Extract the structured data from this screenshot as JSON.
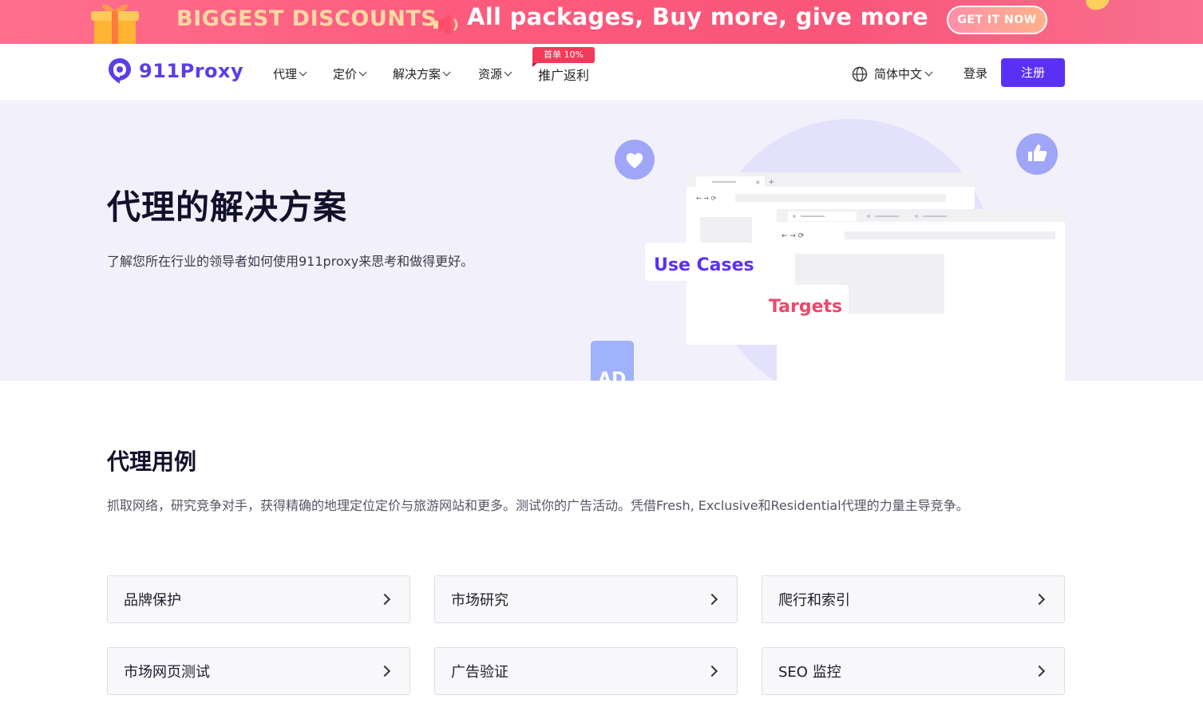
{
  "promo": {
    "headline": "BIGGEST DISCOUNTS",
    "slogan": "All packages, Buy more, give more",
    "cta": "GET IT NOW",
    "colors": {
      "background": "#fd5a7c",
      "headline": "#ffd9a3"
    }
  },
  "nav": {
    "logo_text": "911Proxy",
    "items": [
      {
        "label": "代理",
        "dropdown": true
      },
      {
        "label": "定价",
        "dropdown": true
      },
      {
        "label": "解决方案",
        "dropdown": true
      },
      {
        "label": "资源",
        "dropdown": true
      },
      {
        "label": "推广返利",
        "dropdown": false
      }
    ],
    "affiliate_badge": "首单 10%",
    "language": "简体中文",
    "login": "登录",
    "signup": "注册",
    "accent_color": "#5b30f6"
  },
  "hero": {
    "title": "代理的解决方案",
    "subtitle": "了解您所在行业的领导者如何使用911proxy来思考和做得更好。",
    "illustration": {
      "label_use_cases": "Use Cases",
      "label_targets": "Targets",
      "label_ad": "AD",
      "icons": [
        "heart-icon",
        "thumbs-up-icon"
      ]
    }
  },
  "use_cases": {
    "title": "代理用例",
    "description": "抓取网络，研究竞争对手，获得精确的地理定位定价与旅游网站和更多。测试你的广告活动。凭借Fresh, Exclusive和Residential代理的力量主导竞争。",
    "cards": [
      {
        "label": "品牌保护"
      },
      {
        "label": "市场研究"
      },
      {
        "label": "爬行和索引"
      },
      {
        "label": "市场网页测试"
      },
      {
        "label": "广告验证"
      },
      {
        "label": "SEO 监控"
      }
    ]
  }
}
